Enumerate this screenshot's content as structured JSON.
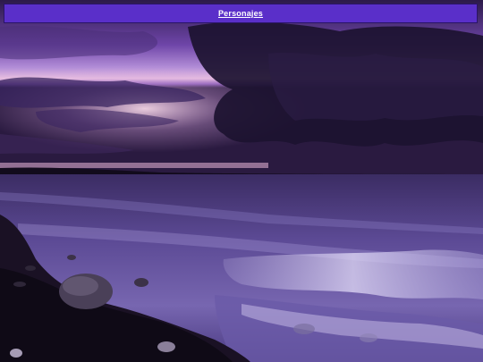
{
  "header": {
    "title_link": "Personajes",
    "bar_color": "#5a2fc9"
  },
  "background": {
    "description_icon": "seascape-sunset-image",
    "palette": {
      "sky_light": "#c9a6e6",
      "sky_mid": "#7b4fb0",
      "cloud_dark": "#221634",
      "glow": "#f2c6d8",
      "water": "#5d4a96",
      "foam": "#d9d1f0",
      "shore": "#120b1c"
    }
  }
}
